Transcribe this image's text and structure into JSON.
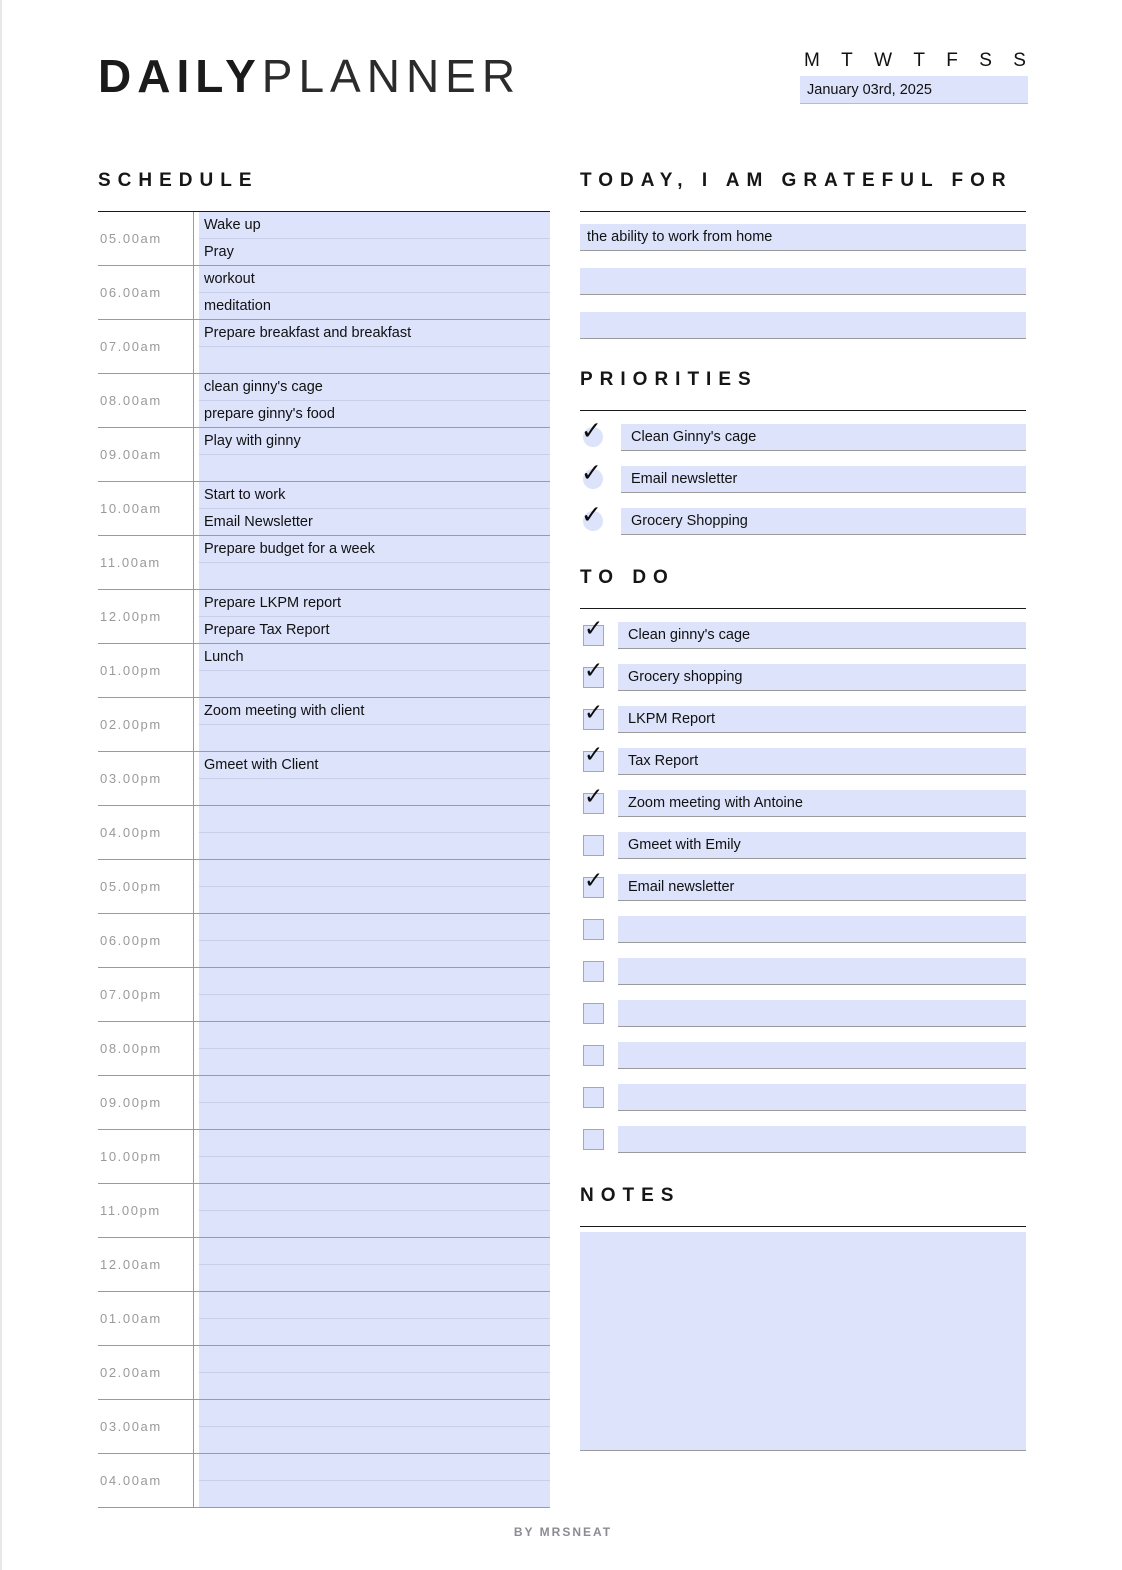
{
  "header": {
    "title_bold": "DAILY",
    "title_light": "PLANNER",
    "days": [
      "M",
      "T",
      "W",
      "T",
      "F",
      "S",
      "S"
    ],
    "date": "January 03rd, 2025"
  },
  "colors": {
    "field_blue": "#dce3fa",
    "rule_dark": "#1a1a1a",
    "rule_gray": "#9b9b9b",
    "time_label": "#9a9a9a",
    "footer_text": "#8b8b93"
  },
  "schedule": {
    "heading": "SCHEDULE",
    "hours": [
      {
        "time": "05.00am",
        "lines": [
          "Wake up",
          "Pray"
        ]
      },
      {
        "time": "06.00am",
        "lines": [
          "workout",
          "meditation"
        ]
      },
      {
        "time": "07.00am",
        "lines": [
          "Prepare breakfast and breakfast",
          ""
        ]
      },
      {
        "time": "08.00am",
        "lines": [
          "clean ginny's cage",
          "prepare ginny's food"
        ]
      },
      {
        "time": "09.00am",
        "lines": [
          "Play with ginny",
          ""
        ]
      },
      {
        "time": "10.00am",
        "lines": [
          "Start to work",
          "Email Newsletter"
        ]
      },
      {
        "time": "11.00am",
        "lines": [
          "Prepare budget for a week",
          ""
        ]
      },
      {
        "time": "12.00pm",
        "lines": [
          "Prepare LKPM report",
          "Prepare Tax Report"
        ]
      },
      {
        "time": "01.00pm",
        "lines": [
          "Lunch",
          ""
        ]
      },
      {
        "time": "02.00pm",
        "lines": [
          "Zoom meeting with client",
          ""
        ]
      },
      {
        "time": "03.00pm",
        "lines": [
          "Gmeet with Client",
          ""
        ]
      },
      {
        "time": "04.00pm",
        "lines": [
          "",
          ""
        ]
      },
      {
        "time": "05.00pm",
        "lines": [
          "",
          ""
        ]
      },
      {
        "time": "06.00pm",
        "lines": [
          "",
          ""
        ]
      },
      {
        "time": "07.00pm",
        "lines": [
          "",
          ""
        ]
      },
      {
        "time": "08.00pm",
        "lines": [
          "",
          ""
        ]
      },
      {
        "time": "09.00pm",
        "lines": [
          "",
          ""
        ]
      },
      {
        "time": "10.00pm",
        "lines": [
          "",
          ""
        ]
      },
      {
        "time": "11.00pm",
        "lines": [
          "",
          ""
        ]
      },
      {
        "time": "12.00am",
        "lines": [
          "",
          ""
        ]
      },
      {
        "time": "01.00am",
        "lines": [
          "",
          ""
        ]
      },
      {
        "time": "02.00am",
        "lines": [
          "",
          ""
        ]
      },
      {
        "time": "03.00am",
        "lines": [
          "",
          ""
        ]
      },
      {
        "time": "04.00am",
        "lines": [
          "",
          ""
        ]
      }
    ]
  },
  "gratitude": {
    "heading": "TODAY, I AM GRATEFUL FOR",
    "items": [
      "the ability to work from home",
      "",
      ""
    ]
  },
  "priorities": {
    "heading": "PRIORITIES",
    "items": [
      {
        "label": "Clean Ginny's cage",
        "checked": true
      },
      {
        "label": "Email newsletter",
        "checked": true
      },
      {
        "label": "Grocery Shopping",
        "checked": true
      }
    ]
  },
  "todo": {
    "heading": "TO DO",
    "items": [
      {
        "label": "Clean ginny's cage",
        "checked": true
      },
      {
        "label": "Grocery shopping",
        "checked": true
      },
      {
        "label": "LKPM Report",
        "checked": true
      },
      {
        "label": "Tax Report",
        "checked": true
      },
      {
        "label": "Zoom meeting with Antoine",
        "checked": true
      },
      {
        "label": "Gmeet with Emily",
        "checked": false
      },
      {
        "label": "Email newsletter",
        "checked": true
      },
      {
        "label": "",
        "checked": false
      },
      {
        "label": "",
        "checked": false
      },
      {
        "label": "",
        "checked": false
      },
      {
        "label": "",
        "checked": false
      },
      {
        "label": "",
        "checked": false
      },
      {
        "label": "",
        "checked": false
      }
    ]
  },
  "notes": {
    "heading": "NOTES",
    "content": ""
  },
  "footer": {
    "text": "BY MRSNEAT"
  },
  "icons": {
    "check": "✓"
  }
}
